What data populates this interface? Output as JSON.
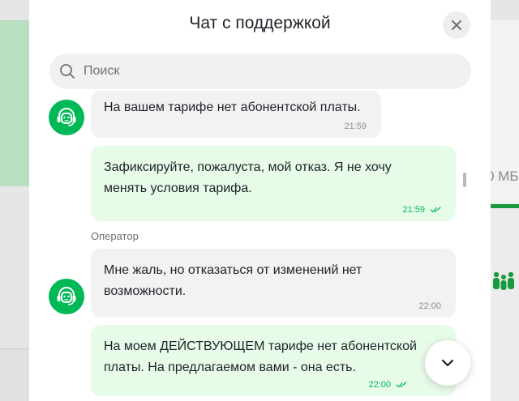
{
  "chat": {
    "title": "Чат с поддержкой",
    "search_placeholder": "Поиск"
  },
  "background": {
    "partial_text": "0 МБ"
  },
  "messages": [
    {
      "direction": "incoming",
      "text": "На вашем тарифе нет абонентской платы.",
      "time": "21:59"
    },
    {
      "direction": "outgoing",
      "text_lines": [
        "Зафиксируйте, пожалуста, мой отказ. Я не хочу",
        "менять условия тарифа."
      ],
      "time": "21:59",
      "status": "read"
    },
    {
      "direction": "incoming",
      "sender": "Оператор",
      "text_lines": [
        "Мне жаль, но отказаться от изменений нет",
        "возможности."
      ],
      "time": "22:00"
    },
    {
      "direction": "outgoing",
      "text_lines": [
        "На моем ДЕЙСТВУЮЩЕМ тарифе нет абонентской",
        "платы. На предлагаемом вами - она есть."
      ],
      "time": "22:00",
      "status": "read"
    }
  ],
  "colors": {
    "accent": "#00b956",
    "outgoing_bubble": "#e7fbe9",
    "incoming_bubble": "#f2f2f2"
  },
  "icons": {
    "avatar": "support-operator-icon",
    "close": "close-icon",
    "search": "search-icon",
    "scroll": "chevron-down-icon",
    "read": "double-check-icon"
  }
}
